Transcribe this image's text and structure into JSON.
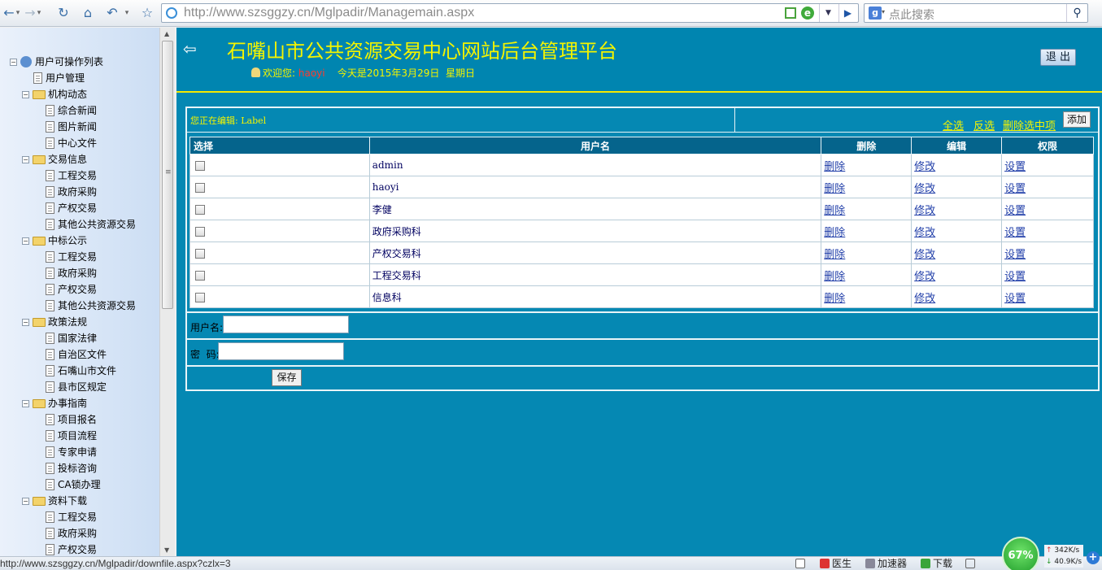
{
  "browser": {
    "url": "http://www.szsggzy.cn/Mglpadir/Managemain.aspx",
    "search_placeholder": "点此搜索",
    "status_url": "http://www.szsggzy.cn/Mglpadir/downfile.aspx?czlx=3",
    "status_items": [
      "医生",
      "加速器",
      "下载"
    ],
    "cpu_percent": "67%",
    "upload_speed": "342K/s",
    "download_speed": "40.9K/s"
  },
  "tree": {
    "root": "用户可操作列表",
    "user_mgmt": "用户管理",
    "groups": [
      {
        "label": "机构动态",
        "items": [
          "综合新闻",
          "图片新闻",
          "中心文件"
        ]
      },
      {
        "label": "交易信息",
        "items": [
          "工程交易",
          "政府采购",
          "产权交易",
          "其他公共资源交易"
        ]
      },
      {
        "label": "中标公示",
        "items": [
          "工程交易",
          "政府采购",
          "产权交易",
          "其他公共资源交易"
        ]
      },
      {
        "label": "政策法规",
        "items": [
          "国家法律",
          "自治区文件",
          "石嘴山市文件",
          "县市区规定"
        ]
      },
      {
        "label": "办事指南",
        "items": [
          "项目报名",
          "项目流程",
          "专家申请",
          "投标咨询",
          "CA锁办理"
        ]
      },
      {
        "label": "资料下载",
        "items": [
          "工程交易",
          "政府采购",
          "产权交易"
        ]
      }
    ]
  },
  "header": {
    "title": "石嘴山市公共资源交易中心网站后台管理平台",
    "welcome_prefix": "欢迎您:",
    "username": "haoyi",
    "date_text": "今天是2015年3月29日",
    "weekday": "星期日",
    "logout": "退 出"
  },
  "editbar": {
    "editing_text": "您正在编辑: Label",
    "select_all": "全选",
    "invert": "反选",
    "delete_selected": "删除选中项",
    "add": "添加"
  },
  "table": {
    "columns": [
      "选择",
      "用户名",
      "删除",
      "编辑",
      "权限"
    ],
    "delete_label": "删除",
    "edit_label": "修改",
    "perm_label": "设置",
    "rows": [
      "admin",
      "haoyi",
      "李健",
      "政府采购科",
      "产权交易科",
      "工程交易科",
      "信息科"
    ]
  },
  "form": {
    "username_label": "用户名:",
    "username_value": "",
    "password_label": "密  码:",
    "password_value": "",
    "save": "保存"
  }
}
